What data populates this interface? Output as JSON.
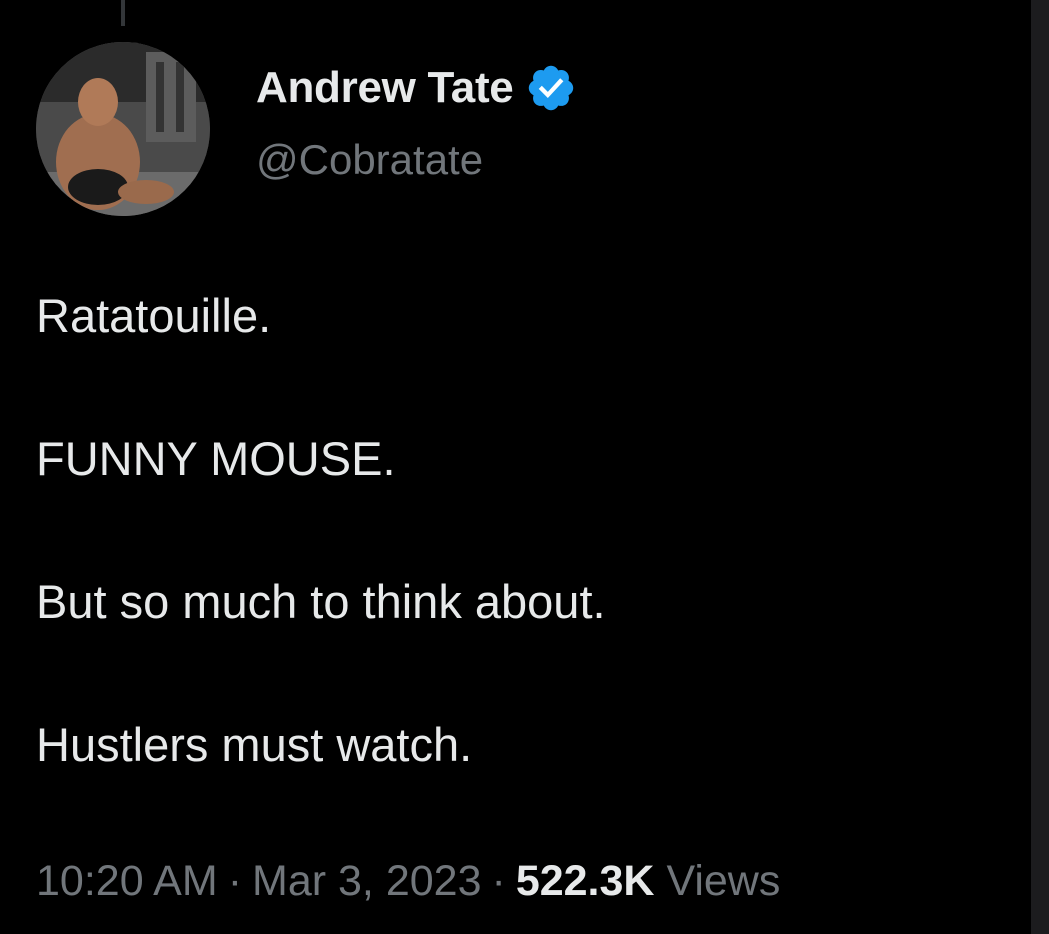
{
  "tweet": {
    "author": {
      "display_name": "Andrew Tate",
      "handle": "@Cobratate",
      "verified": true
    },
    "lines": [
      "Ratatouille.",
      "FUNNY MOUSE.",
      "But so much to think about.",
      "Hustlers must watch."
    ],
    "meta": {
      "time": "10:20 AM",
      "date": "Mar 3, 2023",
      "separator": "·",
      "views_count": "522.3K",
      "views_label": "Views"
    }
  },
  "colors": {
    "background": "#000000",
    "primary_text": "#e7e9ea",
    "secondary_text": "#71767b",
    "verified_badge": "#1d9bf0"
  },
  "icons": {
    "verified": "verified-badge-icon"
  }
}
